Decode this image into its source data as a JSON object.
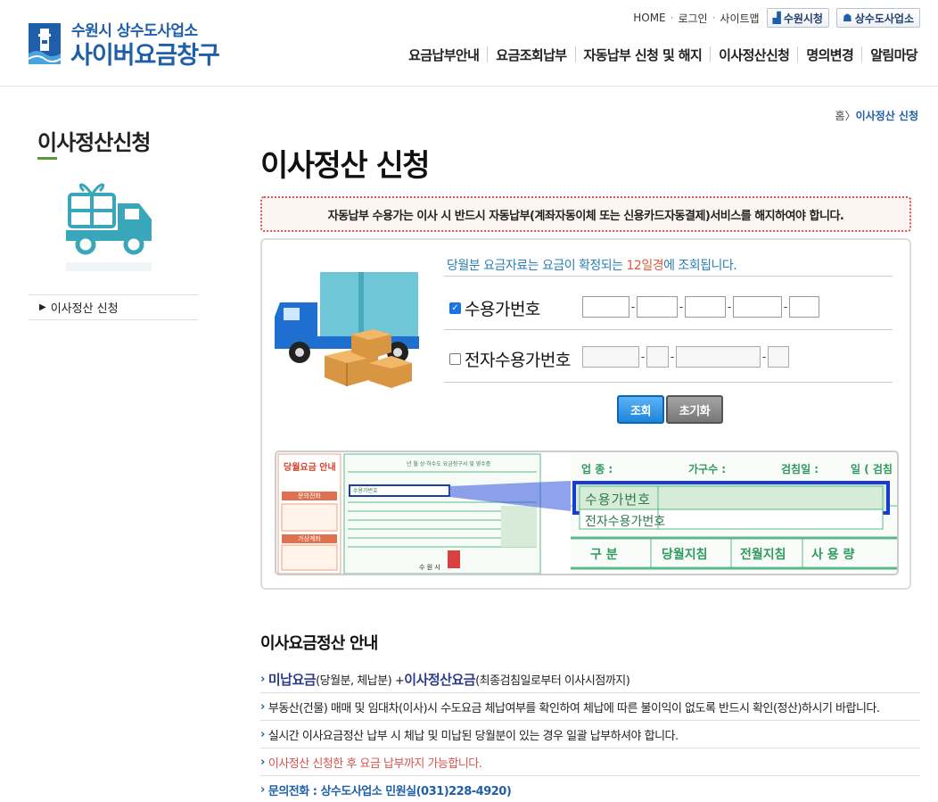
{
  "header": {
    "logo_top": "수원시 상수도사업소",
    "logo_main": "사이버요금창구",
    "util_links": [
      "HOME",
      "로그인",
      "사이트맵"
    ],
    "util_buttons": [
      "수원시청",
      "상수도사업소"
    ],
    "gnb": [
      "요금납부안내",
      "요금조회납부",
      "자동납부 신청 및 해지",
      "이사정산신청",
      "명의변경",
      "알림마당"
    ]
  },
  "sidebar": {
    "title": "이사정산신청",
    "menu_item": "이사정산 신청"
  },
  "breadcrumb": {
    "home": "홈",
    "current": "이사정산 신청"
  },
  "page_title": "이사정산 신청",
  "notice": "자동납부 수용가는 이사 시 반드시 자동납부(계좌자동이체 또는 신용카드자동결제)서비스를 해지하여야 합니다.",
  "form": {
    "info_pre": "당월분 요금자료는 요금이 확정되는 ",
    "info_hl": "12일경",
    "info_post": "에 조회됩니다.",
    "opt1_label": "수용가번호",
    "opt1_checked": true,
    "opt2_label": "전자수용가번호",
    "opt2_checked": false,
    "search_btn": "조회",
    "reset_btn": "초기화"
  },
  "bill_sample": {
    "side_title": "당월요금 안내",
    "box1": "문의전화",
    "box2": "가상계좌",
    "header_text": "년   월  상·하수도 요금청구서 및 영수증",
    "field_label": "수용가번호",
    "zoom_labels": [
      "업 종 :",
      "가구수 :",
      "검침일 :",
      "일 ( 검침"
    ],
    "zoom_field1": "수용가번호",
    "zoom_field2": "전자수용가번호",
    "zoom_cols": [
      "구  분",
      "당월지침",
      "전월지침",
      "사 용 량"
    ],
    "footer_text": "수 원 시"
  },
  "guide": {
    "title": "이사요금정산 안내",
    "row1": {
      "a": "미납요금",
      "b": "(당월분, 체납분) + ",
      "c": "이사정산요금",
      "d": "(최종검침일로부터 이사시점까지)"
    },
    "row2": "부동산(건물) 매매 및 임대차(이사)시 수도요금 체납여부를 확인하여 체납에 따른 불이익이 없도록 반드시 확인(정산)하시기 바랍니다.",
    "row3": "실시간 이사요금정산 납부 시 체납 및 미납된 당월분이 있는 경우 일괄 납부하셔야 합니다.",
    "row4": "이사정산 신청한 후 요금 납부까지 가능합니다.",
    "row5": "문의전화 : 상수도사업소 민원실(031)228-4920)"
  }
}
